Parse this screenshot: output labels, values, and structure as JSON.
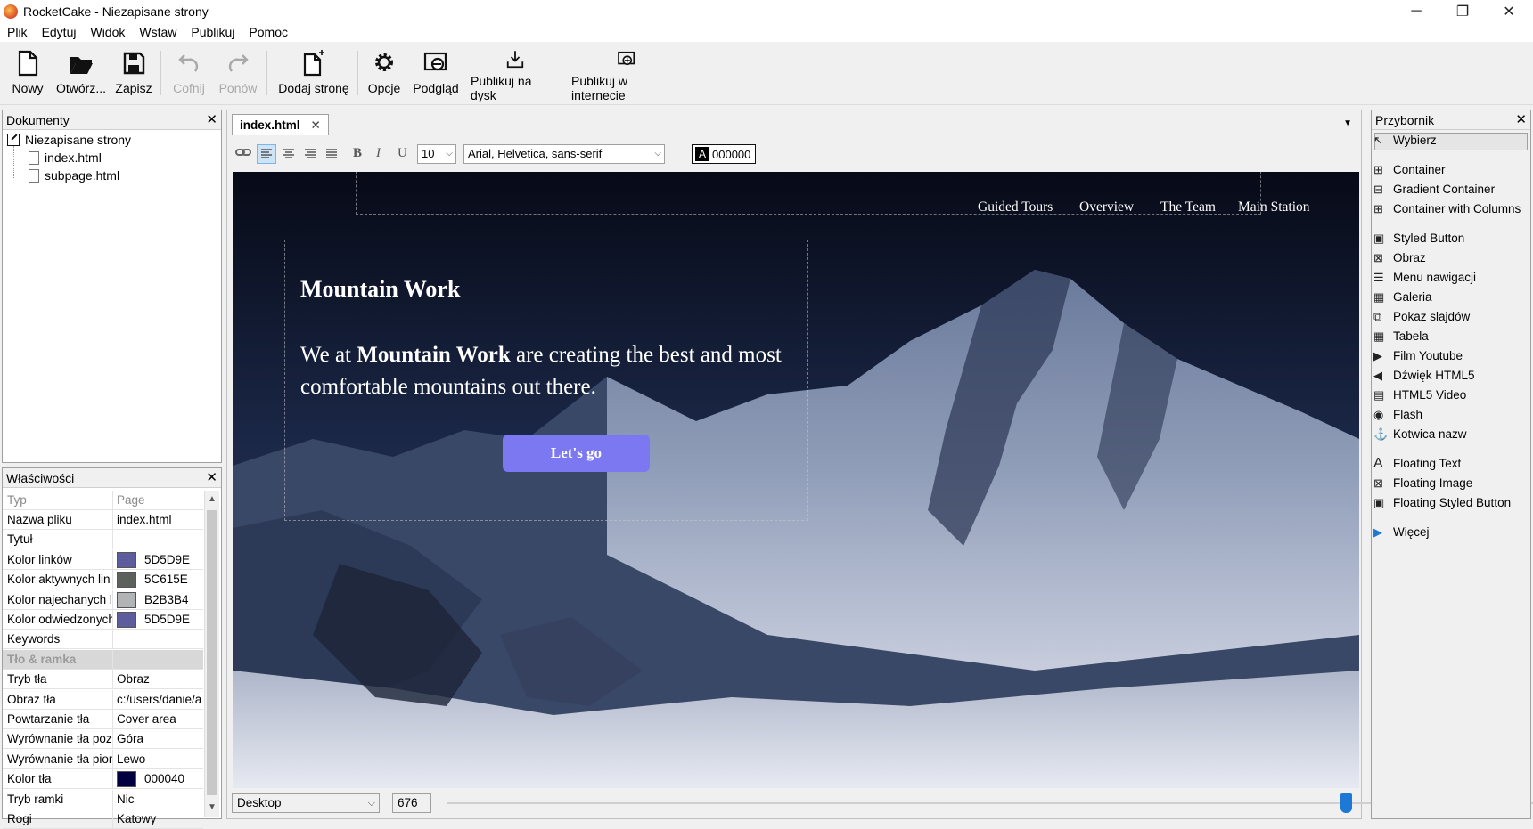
{
  "window": {
    "title": "RocketCake - Niezapisane strony",
    "minimize": "─",
    "maximize": "❐",
    "close": "✕"
  },
  "menu": [
    "Plik",
    "Edytuj",
    "Widok",
    "Wstaw",
    "Publikuj",
    "Pomoc"
  ],
  "toolbar": {
    "new": "Nowy",
    "open": "Otwórz...",
    "save": "Zapisz",
    "undo": "Cofnij",
    "redo": "Ponów",
    "add_page": "Dodaj stronę",
    "options": "Opcje",
    "preview": "Podgląd",
    "publish_disk": "Publikuj na dysk",
    "publish_web": "Publikuj w internecie"
  },
  "documents": {
    "title": "Dokumenty",
    "close": "✕",
    "root": "Niezapisane strony",
    "files": [
      "index.html",
      "subpage.html"
    ]
  },
  "properties": {
    "title": "Właściwości",
    "close": "✕",
    "header": {
      "name": "Typ",
      "value": "Page"
    },
    "rows": [
      {
        "name": "Nazwa pliku",
        "value": "index.html"
      },
      {
        "name": "Tytuł",
        "value": ""
      },
      {
        "name": "Kolor linków",
        "value": "5D5D9E",
        "color": "#5D5D9E"
      },
      {
        "name": "Kolor aktywnych lin",
        "value": "5C615E",
        "color": "#5C615E"
      },
      {
        "name": "Kolor najechanych l",
        "value": "B2B3B4",
        "color": "#B2B3B4"
      },
      {
        "name": "Kolor odwiedzonych",
        "value": "5D5D9E",
        "color": "#5D5D9E"
      },
      {
        "name": "Keywords",
        "value": ""
      },
      {
        "name": "Tło & ramka",
        "value": "",
        "section": true
      },
      {
        "name": "Tryb tła",
        "value": "Obraz"
      },
      {
        "name": "Obraz tła",
        "value": "c:/users/danie/a"
      },
      {
        "name": "Powtarzanie tła",
        "value": "Cover area"
      },
      {
        "name": "Wyrównanie tła poz",
        "value": "Góra"
      },
      {
        "name": "Wyrównanie tła pion",
        "value": "Lewo"
      },
      {
        "name": "Kolor tła",
        "value": "000040",
        "color": "#000040"
      },
      {
        "name": "Tryb ramki",
        "value": "Nic"
      },
      {
        "name": "Rogi",
        "value": "Katowy"
      }
    ]
  },
  "editor": {
    "tab": "index.html",
    "tab_close": "✕",
    "dropdown": "▼",
    "font_size": "10",
    "font_family": "Arial, Helvetica, sans-serif",
    "color_label": "A",
    "color_value": "000000",
    "bold": "B",
    "italic": "I",
    "underline": "U"
  },
  "canvas": {
    "nav": [
      "Guided Tours",
      "Overview",
      "The Team",
      "Main Station"
    ],
    "heading": "Mountain Work",
    "body_pre": "We at ",
    "body_bold": "Mountain Work",
    "body_post": " are creating the best and most comfortable mountains out there.",
    "button": "Let's go",
    "button_color": "#7b78f2"
  },
  "bottom": {
    "device": "Desktop",
    "width": "676"
  },
  "toolbox": {
    "title": "Przybornik",
    "close": "✕",
    "items": [
      {
        "label": "Wybierz",
        "icon": "cursor-icon"
      },
      {
        "label": "Container",
        "icon": "container-icon"
      },
      {
        "label": "Gradient Container",
        "icon": "gradient-container-icon"
      },
      {
        "label": "Container with Columns",
        "icon": "columns-icon"
      },
      {
        "label": "Styled Button",
        "icon": "button-icon"
      },
      {
        "label": "Obraz",
        "icon": "image-icon"
      },
      {
        "label": "Menu nawigacji",
        "icon": "menu-icon"
      },
      {
        "label": "Galeria",
        "icon": "gallery-icon"
      },
      {
        "label": "Pokaz slajdów",
        "icon": "slideshow-icon"
      },
      {
        "label": "Tabela",
        "icon": "table-icon"
      },
      {
        "label": "Film Youtube",
        "icon": "youtube-icon"
      },
      {
        "label": "Dźwięk HTML5",
        "icon": "audio-icon"
      },
      {
        "label": "HTML5 Video",
        "icon": "video-icon"
      },
      {
        "label": "Flash",
        "icon": "flash-icon"
      },
      {
        "label": "Kotwica nazw",
        "icon": "anchor-icon"
      },
      {
        "label": "Floating Text",
        "icon": "text-icon"
      },
      {
        "label": "Floating Image",
        "icon": "floating-image-icon"
      },
      {
        "label": "Floating Styled Button",
        "icon": "floating-button-icon"
      },
      {
        "label": "Więcej",
        "icon": "more-icon"
      }
    ]
  }
}
